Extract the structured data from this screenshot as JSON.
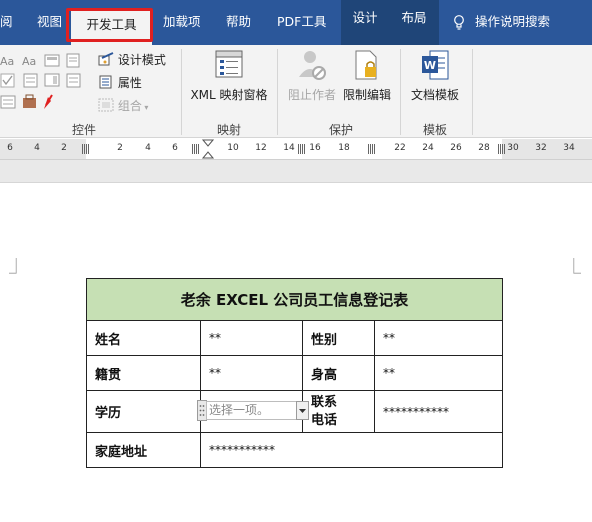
{
  "tabs": {
    "view_partial": "阅",
    "view": "视图",
    "developer": "开发工具",
    "addins": "加载项",
    "help": "帮助",
    "pdf": "PDF工具",
    "design": "设计",
    "layout": "布局",
    "search": "操作说明搜索"
  },
  "ribbon": {
    "controls": {
      "label": "控件",
      "design_mode": "设计模式",
      "properties": "属性",
      "group": "组合"
    },
    "mapping": {
      "label": "映射",
      "xml_pane": "XML 映射窗格"
    },
    "protect": {
      "label": "保护",
      "block_authors": "阻止作者",
      "restrict_editing": "限制编辑"
    },
    "templates": {
      "label": "模板",
      "document_template": "文档模板"
    }
  },
  "ruler": {
    "left_numbers": [
      "6",
      "4",
      "2"
    ],
    "numbers": [
      "2",
      "4",
      "6",
      "10",
      "12",
      "14",
      "16",
      "18",
      "22",
      "24",
      "26",
      "28",
      "30",
      "32",
      "34"
    ]
  },
  "form": {
    "title": "老余 EXCEL 公司员工信息登记表",
    "name_label": "姓名",
    "name_value": "**",
    "gender_label": "性别",
    "gender_value": "**",
    "origin_label": "籍贯",
    "origin_value": "**",
    "height_label": "身高",
    "height_value": "**",
    "education_label": "学历",
    "education_placeholder": "选择一项。",
    "phone_label": "联系电话",
    "phone_value": "***********",
    "address_label": "家庭地址",
    "address_value": "***********"
  },
  "colors": {
    "ribbon_blue": "#2b579a",
    "header_green": "#c6e0b4",
    "highlight_red": "#e02020"
  }
}
